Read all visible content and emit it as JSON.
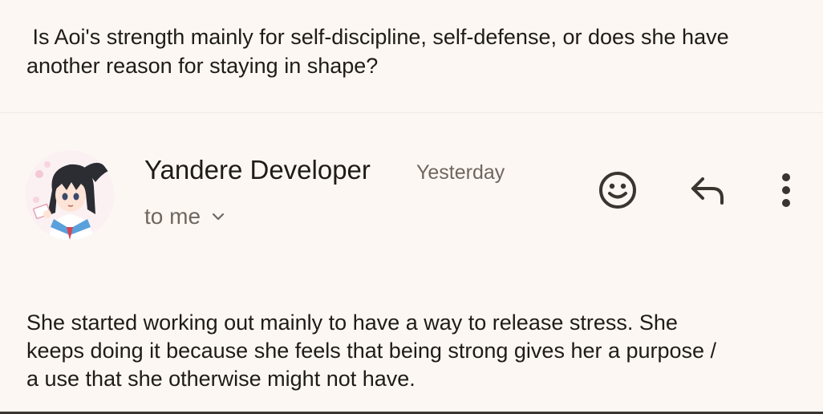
{
  "quoted_message": {
    "text": " Is Aoi's strength mainly for self-discipline, self-defense, or does she have another reason for staying in shape?"
  },
  "email": {
    "sender_name": "Yandere Developer",
    "timestamp": "Yesterday",
    "recipient_label": "to me",
    "body_lines": [
      "She started working out mainly to have a way to release stress. She",
      "keeps doing it because she feels that being strong gives her a purpose /",
      "a use that she otherwise might not have."
    ]
  },
  "icons": {
    "avatar": "anime-girl-avatar",
    "expand": "chevron-down-icon",
    "emoji": "emoji-reaction-icon",
    "reply": "reply-icon",
    "more": "more-vert-icon"
  },
  "colors": {
    "background": "#fdf7f3",
    "text_primary": "#1f1b16",
    "text_secondary": "#6f6660",
    "icon": "#3b3530"
  }
}
